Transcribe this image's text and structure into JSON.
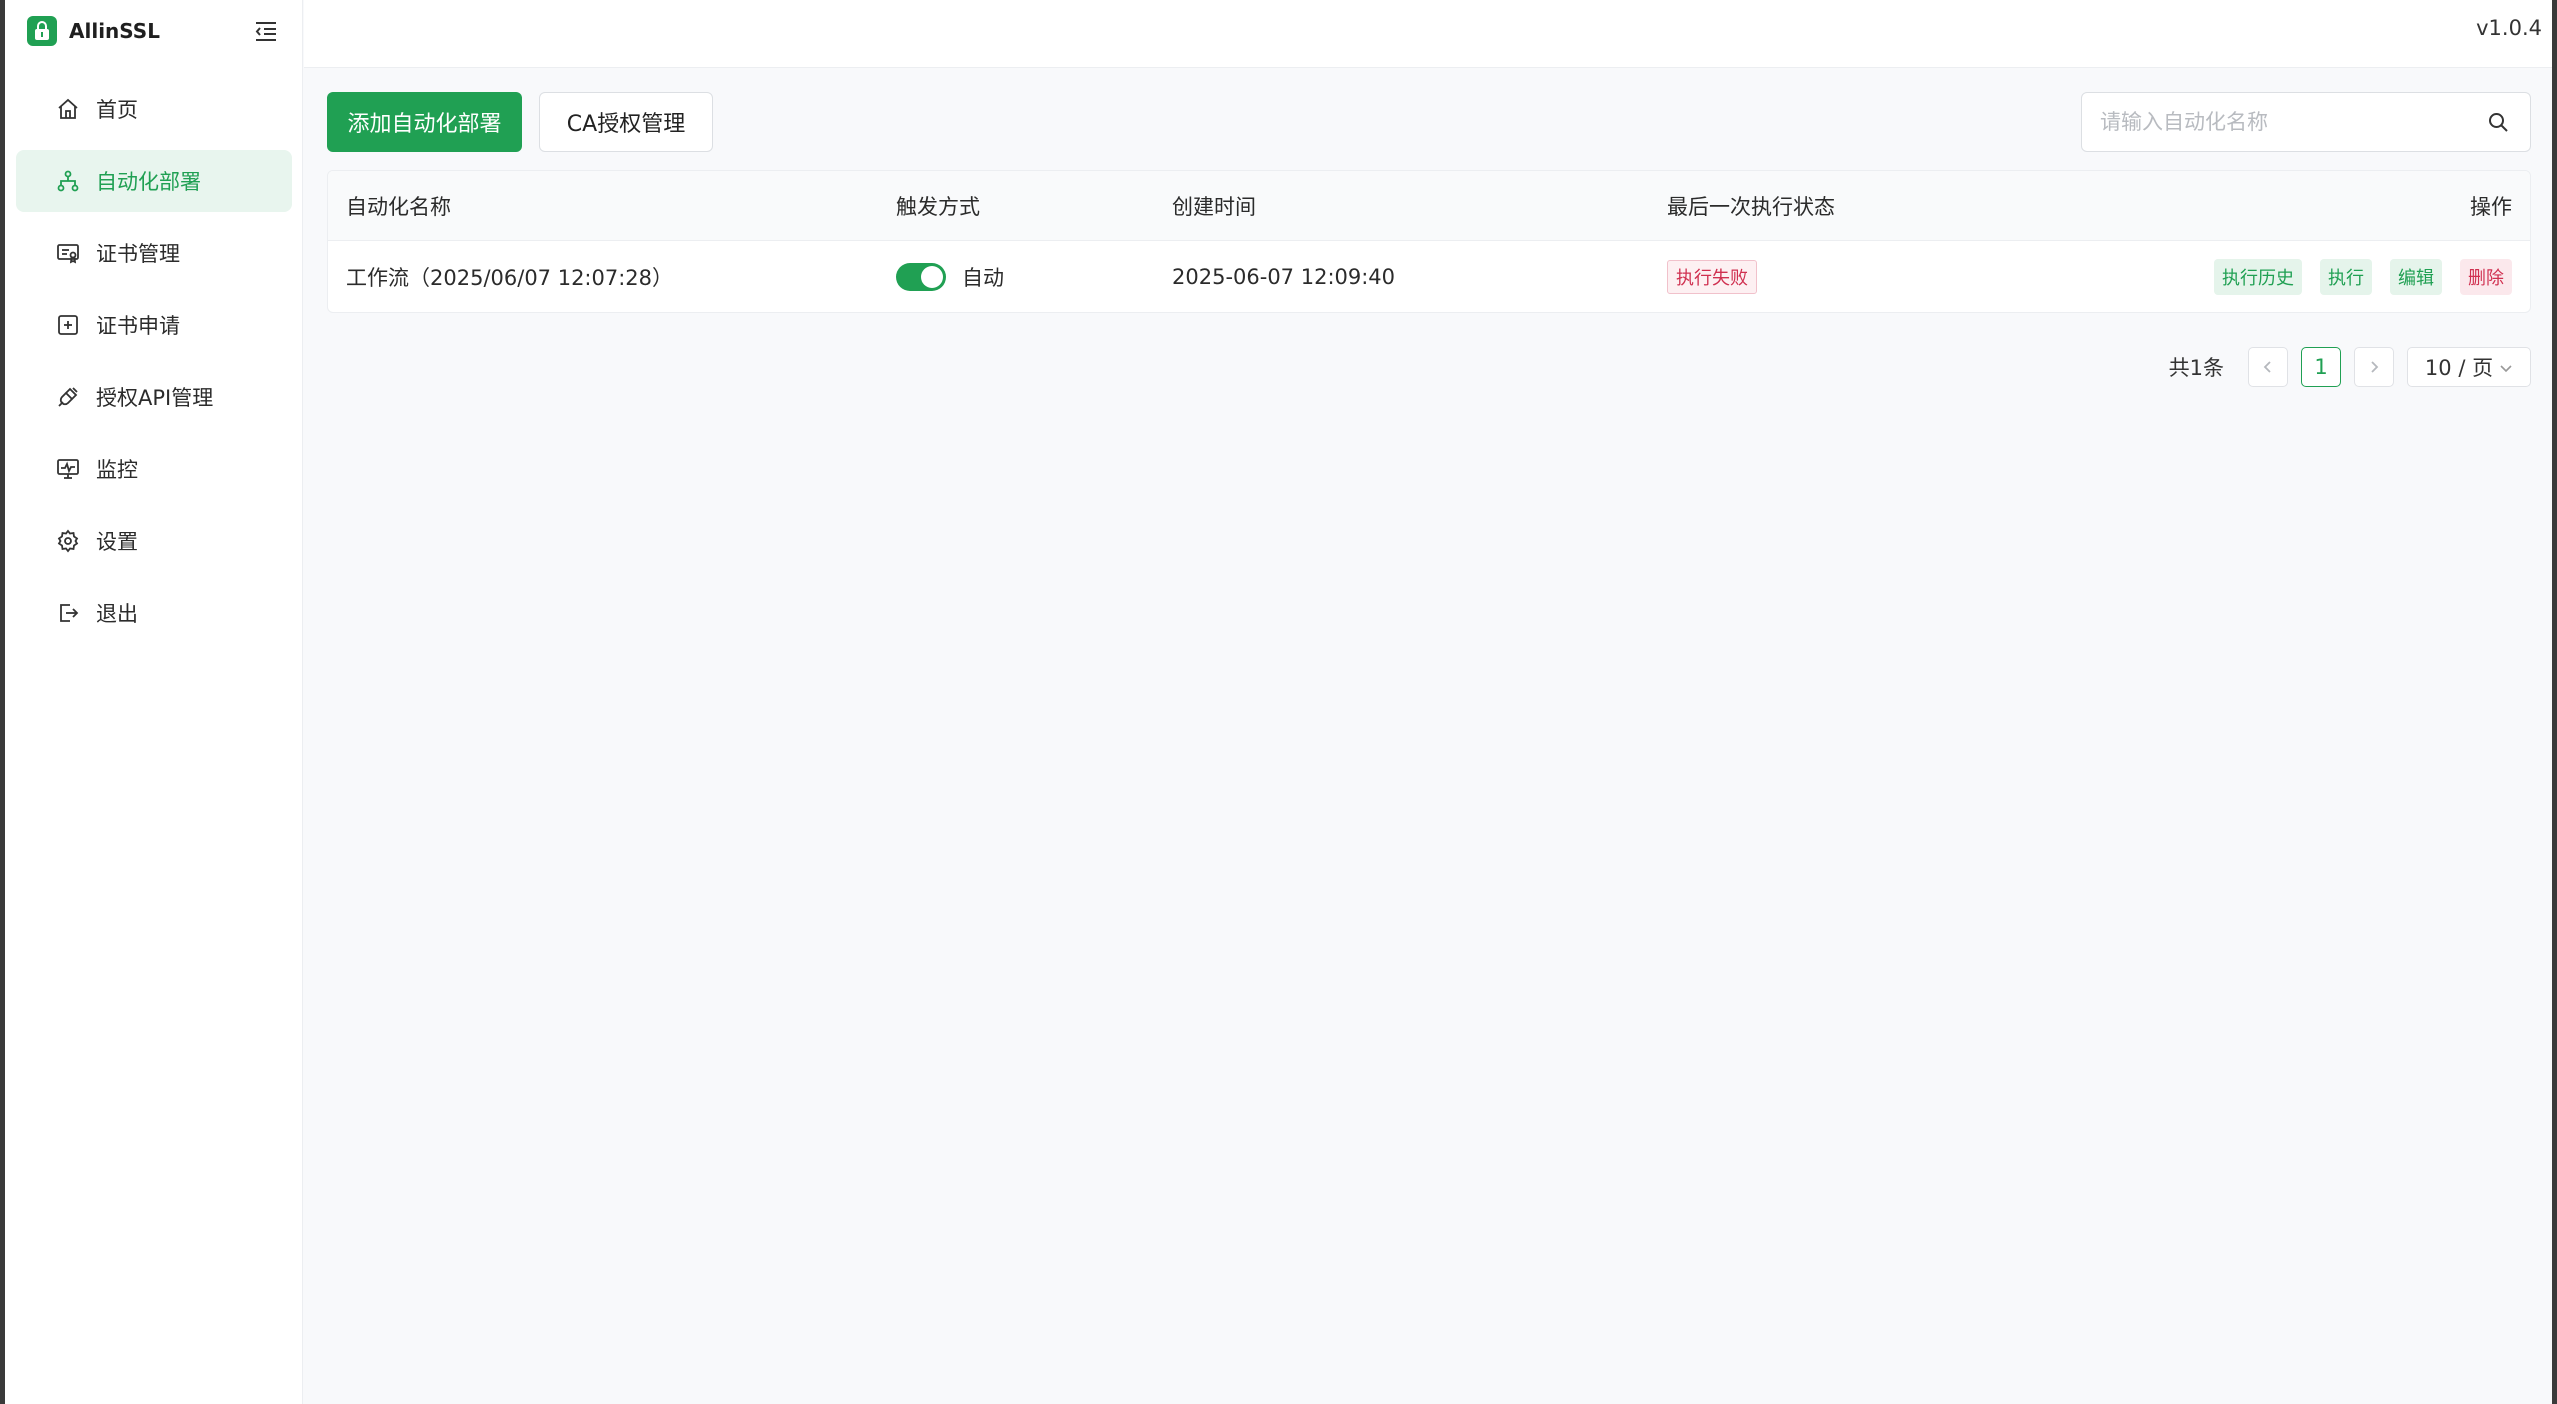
{
  "app": {
    "name": "AllinSSL",
    "version": "v1.0.4"
  },
  "sidebar": {
    "items": [
      {
        "label": "首页",
        "icon": "home-icon"
      },
      {
        "label": "自动化部署",
        "icon": "workflow-icon",
        "active": true
      },
      {
        "label": "证书管理",
        "icon": "certificate-icon"
      },
      {
        "label": "证书申请",
        "icon": "plus-square-icon"
      },
      {
        "label": "授权API管理",
        "icon": "api-plug-icon"
      },
      {
        "label": "监控",
        "icon": "monitor-icon"
      },
      {
        "label": "设置",
        "icon": "gear-icon"
      },
      {
        "label": "退出",
        "icon": "logout-icon"
      }
    ]
  },
  "toolbar": {
    "add_label": "添加自动化部署",
    "ca_label": "CA授权管理",
    "search_placeholder": "请输入自动化名称"
  },
  "table": {
    "columns": [
      "自动化名称",
      "触发方式",
      "创建时间",
      "最后一次执行状态",
      "操作"
    ],
    "rows": [
      {
        "name": "工作流（2025/06/07 12:07:28）",
        "trigger": "自动",
        "trigger_enabled": true,
        "created": "2025-06-07 12:09:40",
        "status": "执行失败",
        "actions": [
          "执行历史",
          "执行",
          "编辑",
          "删除"
        ]
      }
    ]
  },
  "pagination": {
    "total": "共1条",
    "current": "1",
    "page_size": "10 / 页"
  },
  "colors": {
    "primary": "#20a053",
    "danger": "#d03050"
  }
}
